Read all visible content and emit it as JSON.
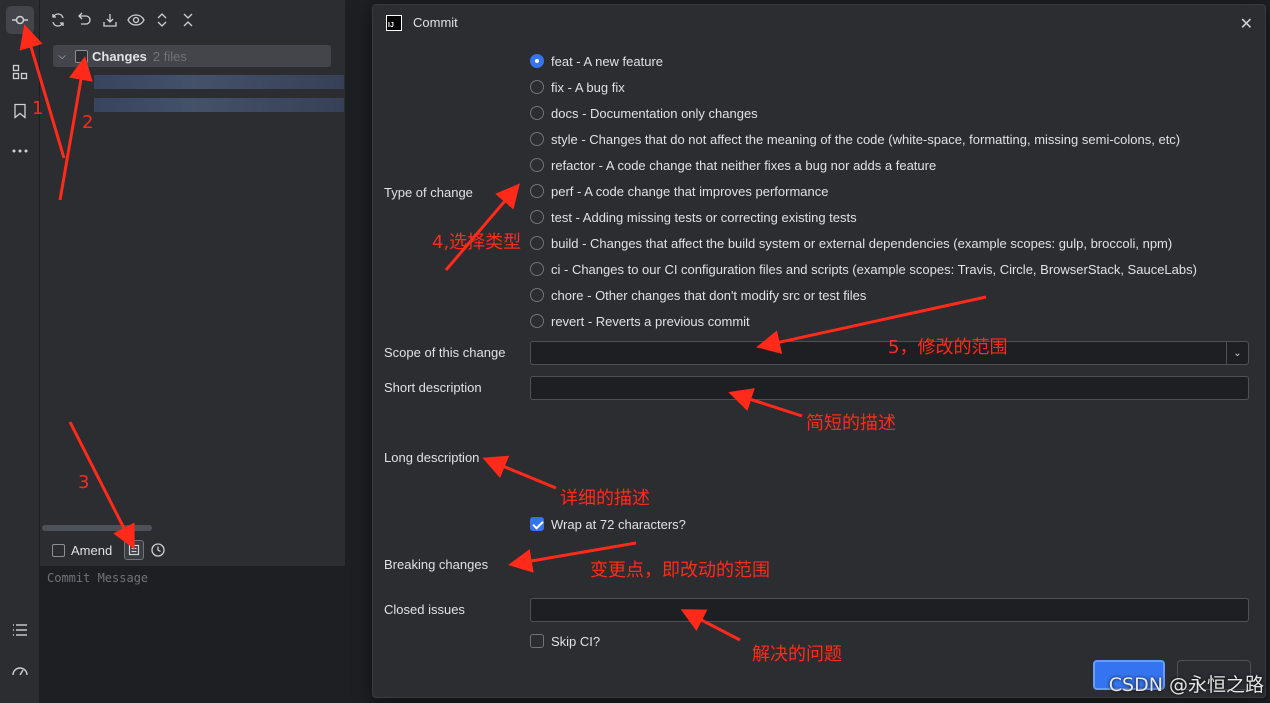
{
  "commit_panel": {
    "changes_label": "Changes",
    "changes_count": "2 files",
    "amend_label": "Amend",
    "commit_message_placeholder": "Commit Message"
  },
  "dialog": {
    "title": "Commit",
    "type_of_change_label": "Type of change",
    "types": [
      {
        "label": "feat - A new feature",
        "selected": true
      },
      {
        "label": "fix - A bug fix",
        "selected": false
      },
      {
        "label": "docs - Documentation only changes",
        "selected": false
      },
      {
        "label": "style - Changes that do not affect the meaning of the code (white-space, formatting, missing semi-colons, etc)",
        "selected": false
      },
      {
        "label": "refactor - A code change that neither fixes a bug nor adds a feature",
        "selected": false
      },
      {
        "label": "perf - A code change that improves performance",
        "selected": false
      },
      {
        "label": "test - Adding missing tests or correcting existing tests",
        "selected": false
      },
      {
        "label": "build - Changes that affect the build system or external dependencies (example scopes: gulp, broccoli, npm)",
        "selected": false
      },
      {
        "label": "ci - Changes to our CI configuration files and scripts (example scopes: Travis, Circle, BrowserStack, SauceLabs)",
        "selected": false
      },
      {
        "label": "chore - Other changes that don't modify src or test files",
        "selected": false
      },
      {
        "label": "revert - Reverts a previous commit",
        "selected": false
      }
    ],
    "scope_label": "Scope of this change",
    "short_desc_label": "Short description",
    "long_desc_label": "Long description",
    "wrap_label": "Wrap at 72 characters?",
    "wrap_checked": true,
    "breaking_label": "Breaking changes",
    "closed_issues_label": "Closed issues",
    "skip_ci_label": "Skip CI?",
    "skip_ci_checked": false
  },
  "annotations": {
    "n1": "1",
    "n2": "2",
    "n3": "3",
    "select_type": "4,选择类型",
    "scope": "5，修改的范围",
    "short": "简短的描述",
    "long": "详细的描述",
    "breaking": "变更点，即改动的范围",
    "closed": "解决的问题"
  },
  "watermark": "CSDN @永恒之路",
  "colors": {
    "accent": "#3574f0",
    "annotation": "#ff2a1a"
  }
}
